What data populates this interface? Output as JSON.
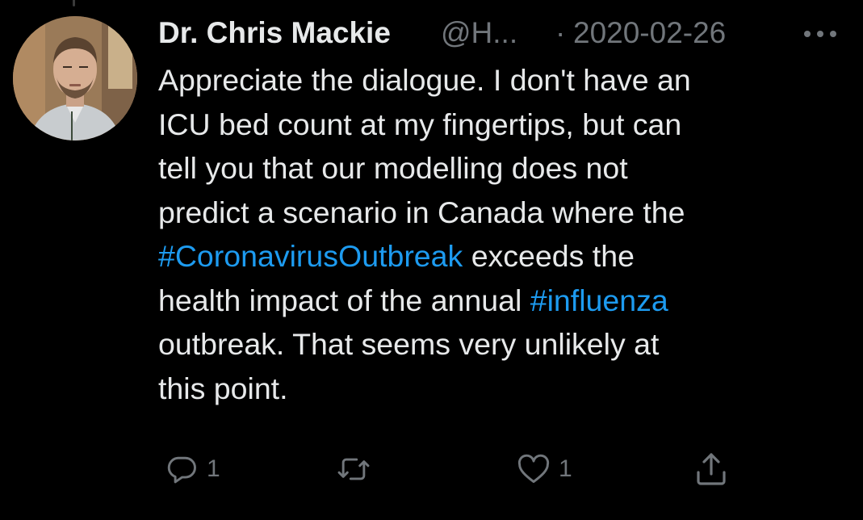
{
  "tweet": {
    "author": {
      "display_name": "Dr. Chris Mackie",
      "handle": "@H...",
      "avatar": "profile-photo"
    },
    "separator": "·",
    "date": "2020-02-26",
    "more_icon": "more-horizontal-icon",
    "text": {
      "part1": "Appreciate the dialogue. I don't have an",
      "part2": "ICU bed count at my fingertips, but can",
      "part3": "tell you that our modelling does not",
      "part4": "predict a scenario in Canada where the",
      "hashtag1": "#CoronavirusOutbreak",
      "part5": " exceeds the",
      "part6": "health impact of the annual ",
      "hashtag2": "#influenza",
      "part7": "outbreak. That seems very unlikely at",
      "part8": "this point."
    },
    "actions": {
      "reply": {
        "icon": "reply-icon",
        "count": "1"
      },
      "retweet": {
        "icon": "retweet-icon",
        "count": ""
      },
      "like": {
        "icon": "heart-icon",
        "count": "1"
      },
      "share": {
        "icon": "share-icon"
      }
    }
  },
  "colors": {
    "background": "#000000",
    "text": "#e7e9ea",
    "secondary": "#71767b",
    "hashtag": "#1d9bf0"
  }
}
